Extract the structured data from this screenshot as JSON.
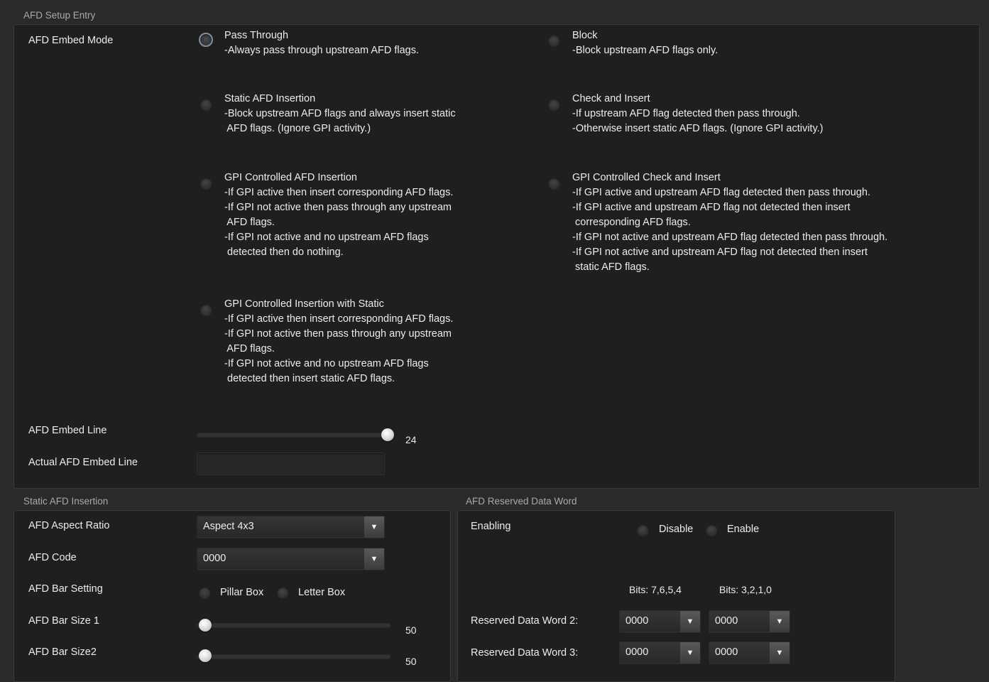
{
  "afd_setup": {
    "title": "AFD Setup Entry",
    "embed_mode_label": "AFD Embed Mode",
    "options": [
      {
        "title": "Pass Through",
        "lines": [
          "-Always pass through upstream AFD flags."
        ],
        "selected": true
      },
      {
        "title": "Block",
        "lines": [
          "-Block upstream AFD flags only."
        ],
        "selected": false
      },
      {
        "title": "Static AFD Insertion",
        "lines": [
          "-Block upstream AFD flags and always insert static",
          " AFD flags. (Ignore GPI activity.)"
        ],
        "selected": false
      },
      {
        "title": "Check and Insert",
        "lines": [
          "-If upstream AFD flag detected then pass through.",
          "-Otherwise insert static AFD flags. (Ignore GPI activity.)"
        ],
        "selected": false
      },
      {
        "title": "GPI Controlled AFD Insertion",
        "lines": [
          "-If GPI active then insert corresponding AFD flags.",
          "-If GPI not active then pass through any upstream",
          " AFD flags.",
          "-If GPI not active and no upstream AFD flags",
          " detected then do nothing."
        ],
        "selected": false
      },
      {
        "title": "GPI Controlled Check and Insert",
        "lines": [
          "-If GPI active and upstream AFD flag detected then pass through.",
          "-If GPI active and upstream AFD flag not detected then insert",
          " corresponding AFD flags.",
          "-If GPI not active and upstream AFD flag detected then pass through.",
          "-If GPI not active and upstream AFD flag not detected then insert",
          " static AFD flags."
        ],
        "selected": false
      },
      {
        "title": "GPI Controlled Insertion with Static",
        "lines": [
          "-If GPI active then insert corresponding AFD flags.",
          "-If GPI not active then pass through any upstream",
          " AFD flags.",
          "-If GPI not active and no upstream AFD flags",
          " detected then insert static AFD flags."
        ],
        "selected": false
      }
    ],
    "embed_line_label": "AFD Embed Line",
    "embed_line_value": "24",
    "embed_line_fraction": 1.0,
    "actual_embed_line_label": "Actual AFD Embed Line",
    "actual_embed_line_value": ""
  },
  "static_afd": {
    "title": "Static AFD Insertion",
    "aspect_ratio_label": "AFD Aspect Ratio",
    "aspect_ratio_value": "Aspect 4x3",
    "code_label": "AFD Code",
    "code_value": "0000",
    "bar_setting_label": "AFD Bar Setting",
    "bar_options": [
      "Pillar Box",
      "Letter Box"
    ],
    "bar_size1_label": "AFD Bar Size 1",
    "bar_size1_value": "50",
    "bar_size1_fraction": 0.0,
    "bar_size2_label": "AFD Bar Size2",
    "bar_size2_value": "50",
    "bar_size2_fraction": 0.0
  },
  "reserved": {
    "title": "AFD Reserved Data Word",
    "enabling_label": "Enabling",
    "enabling_options": [
      "Disable",
      "Enable"
    ],
    "bits_high": "Bits: 7,6,5,4",
    "bits_low": "Bits: 3,2,1,0",
    "word2_label": "Reserved Data Word 2:",
    "word2_high": "0000",
    "word2_low": "0000",
    "word3_label": "Reserved Data Word 3:",
    "word3_high": "0000",
    "word3_low": "0000"
  },
  "icons": {
    "dropdown": "triangle-down-icon"
  },
  "colors": {
    "background": "#2a2a2a",
    "panel": "#1f1f1f",
    "text": "#ececec",
    "selected_ring": "#7e8fa2"
  }
}
